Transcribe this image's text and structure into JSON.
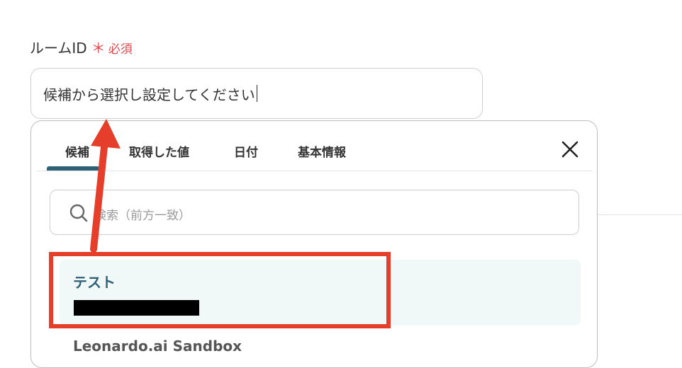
{
  "field": {
    "label": "ルームID",
    "required_star": "＊",
    "required_text": "必須",
    "input_value": "候補から選択し設定してください"
  },
  "dropdown": {
    "tabs": [
      "候補",
      "取得した値",
      "日付",
      "基本情報"
    ],
    "active_tab": "候補",
    "search_placeholder": "検索（前方一致）",
    "options": [
      {
        "name": "テスト",
        "id": "[redacted]",
        "selected": true
      },
      {
        "name": "Leonardo.ai Sandbox"
      }
    ]
  },
  "annotations": {
    "highlight_color": "#e53e2a",
    "arrow_color": "#e53e2a"
  },
  "colors": {
    "accent": "#2f6176",
    "required": "#e5484d",
    "selected_bg": "#f1f8f8"
  }
}
